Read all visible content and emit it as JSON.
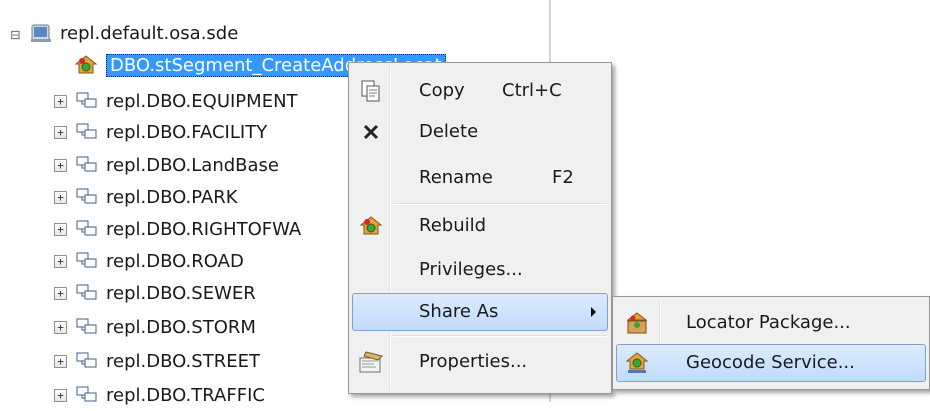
{
  "tree": {
    "root": {
      "label": "repl.default.osa.sde",
      "expander": "⊟",
      "icon": "database-icon"
    },
    "selected": {
      "label": "DBO.stSegment_CreateAddressLocat",
      "icon": "address-locator-icon"
    },
    "items": [
      {
        "label": "repl.DBO.EQUIPMENT",
        "expander": "+",
        "icon": "feature-dataset-icon"
      },
      {
        "label": "repl.DBO.FACILITY",
        "expander": "+",
        "icon": "feature-dataset-icon"
      },
      {
        "label": "repl.DBO.LandBase",
        "expander": "+",
        "icon": "feature-dataset-icon"
      },
      {
        "label": "repl.DBO.PARK",
        "expander": "+",
        "icon": "feature-dataset-icon"
      },
      {
        "label": "repl.DBO.RIGHTOFWA",
        "expander": "+",
        "icon": "feature-dataset-icon"
      },
      {
        "label": "repl.DBO.ROAD",
        "expander": "+",
        "icon": "feature-dataset-icon"
      },
      {
        "label": "repl.DBO.SEWER",
        "expander": "+",
        "icon": "feature-dataset-icon"
      },
      {
        "label": "repl.DBO.STORM",
        "expander": "+",
        "icon": "feature-dataset-icon"
      },
      {
        "label": "repl.DBO.STREET",
        "expander": "+",
        "icon": "feature-dataset-icon"
      },
      {
        "label": "repl.DBO.TRAFFIC",
        "expander": "+",
        "icon": "feature-dataset-icon"
      }
    ]
  },
  "context_menu": {
    "copy": {
      "label": "Copy",
      "shortcut": "Ctrl+C",
      "icon": "copy-icon"
    },
    "delete": {
      "label": "Delete",
      "icon": "delete-x-icon"
    },
    "rename": {
      "label": "Rename",
      "shortcut": "F2"
    },
    "rebuild": {
      "label": "Rebuild",
      "icon": "rebuild-locator-icon"
    },
    "privileges": {
      "label": "Privileges..."
    },
    "share_as": {
      "label": "Share As",
      "icon": "submenu-arrow-icon"
    },
    "properties": {
      "label": "Properties...",
      "icon": "properties-icon"
    }
  },
  "submenu": {
    "locator_package": {
      "label": "Locator Package...",
      "icon": "locator-package-icon"
    },
    "geocode_service": {
      "label": "Geocode Service...",
      "icon": "geocode-service-icon"
    }
  },
  "colors": {
    "selection": "#3399ff",
    "menu_background": "#f0f0f0",
    "menu_highlight": "#c1dbfc",
    "menu_highlight_border": "#7da2ce"
  }
}
